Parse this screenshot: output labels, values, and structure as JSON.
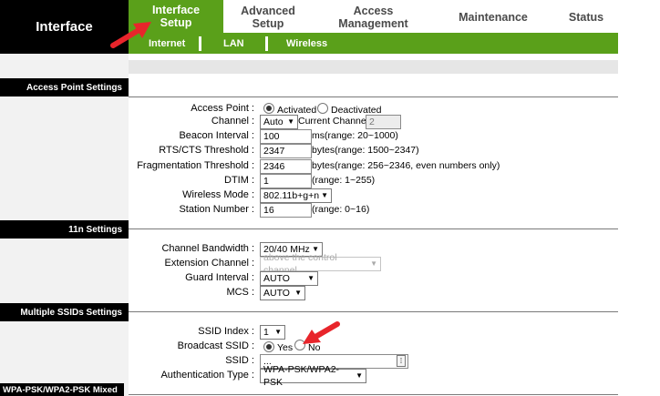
{
  "header": {
    "brand": "Interface",
    "nav": [
      "Interface Setup",
      "Advanced Setup",
      "Access Management",
      "Maintenance",
      "Status"
    ],
    "subnav": [
      "Internet",
      "LAN",
      "Wireless"
    ]
  },
  "sections": {
    "ap": "Access Point Settings",
    "n11": "11n Settings",
    "ssids": "Multiple SSIDs Settings",
    "bottom": "WPA-PSK/WPA2-PSK Mixed"
  },
  "ap": {
    "access_point_label": "Access Point :",
    "activated": "Activated",
    "deactivated": "Deactivated",
    "channel_label": "Channel :",
    "channel_value": "Auto",
    "current_channel_label": "Current Channel:",
    "current_channel_value": "2",
    "beacon_label": "Beacon Interval :",
    "beacon_value": "100",
    "beacon_hint": "ms(range: 20~1000)",
    "rts_label": "RTS/CTS Threshold :",
    "rts_value": "2347",
    "rts_hint": "bytes(range: 1500~2347)",
    "frag_label": "Fragmentation Threshold :",
    "frag_value": "2346",
    "frag_hint": "bytes(range: 256~2346, even numbers only)",
    "dtim_label": "DTIM :",
    "dtim_value": "1",
    "dtim_hint": "(range: 1~255)",
    "mode_label": "Wireless Mode :",
    "mode_value": "802.11b+g+n",
    "station_label": "Station Number :",
    "station_value": "16",
    "station_hint": "(range: 0~16)"
  },
  "n11": {
    "bw_label": "Channel Bandwidth :",
    "bw_value": "20/40 MHz",
    "ext_label": "Extension Channel :",
    "ext_value": "above the control channel",
    "guard_label": "Guard Interval :",
    "guard_value": "AUTO",
    "mcs_label": "MCS :",
    "mcs_value": "AUTO"
  },
  "ssid": {
    "index_label": "SSID Index :",
    "index_value": "1",
    "broadcast_label": "Broadcast SSID :",
    "yes": "Yes",
    "no": "No",
    "ssid_label": "SSID :",
    "ssid_value": "...",
    "auth_label": "Authentication Type :",
    "auth_value": "WPA-PSK/WPA2-PSK"
  },
  "colors": {
    "accent": "#5aa01a",
    "arrow": "#e8252b"
  }
}
